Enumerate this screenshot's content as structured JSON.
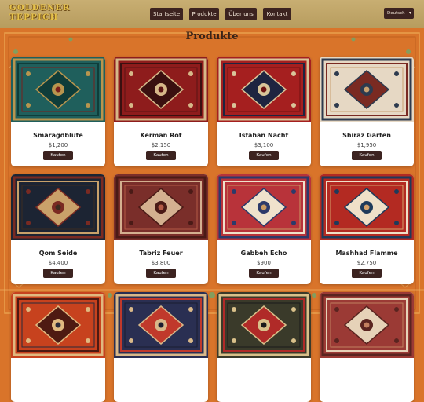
{
  "logo": {
    "line1": "GOLDENER",
    "line2": "TEPPICH"
  },
  "nav": [
    {
      "label": "Startseite"
    },
    {
      "label": "Produkte"
    },
    {
      "label": "Über uns"
    },
    {
      "label": "Kontakt"
    }
  ],
  "language": {
    "selected": "Deutsch"
  },
  "page_title": "Produkte",
  "buy_label": "Kaufen",
  "products": [
    {
      "name": "Smaragdblüte",
      "price": "$1,200",
      "colors": [
        "#1f5f5c",
        "#0f3d3a",
        "#b8954e",
        "#7a1f1c"
      ]
    },
    {
      "name": "Kerman Rot",
      "price": "$2,150",
      "colors": [
        "#8e1c1c",
        "#3a1010",
        "#d6b889",
        "#5b1414"
      ]
    },
    {
      "name": "Isfahan Nacht",
      "price": "$3,100",
      "colors": [
        "#a51f1f",
        "#1e2440",
        "#d9c59a",
        "#6e1212"
      ]
    },
    {
      "name": "Shiraz Garten",
      "price": "$1,950",
      "colors": [
        "#e6d8c4",
        "#7a2a22",
        "#2d3a4e",
        "#c9a070"
      ]
    },
    {
      "name": "Qom Seide",
      "price": "$4,400",
      "colors": [
        "#1c2433",
        "#c9a16a",
        "#7a2a22",
        "#3b2b20"
      ]
    },
    {
      "name": "Tabriz Feuer",
      "price": "$3,800",
      "colors": [
        "#7a2e2a",
        "#d4b090",
        "#4a1a16",
        "#b45a46"
      ]
    },
    {
      "name": "Gabbeh Echo",
      "price": "$900",
      "colors": [
        "#b8333a",
        "#efe2cc",
        "#2c3a6a",
        "#c99a62"
      ]
    },
    {
      "name": "Mashhad Flamme",
      "price": "$2,750",
      "colors": [
        "#b32a22",
        "#efe0c8",
        "#1e3a5a",
        "#d6a26a"
      ]
    },
    {
      "name": "",
      "price": "",
      "colors": [
        "#c7421e",
        "#4e1a12",
        "#e0b980",
        "#2a2a3a"
      ]
    },
    {
      "name": "",
      "price": "",
      "colors": [
        "#2a2f52",
        "#c0392b",
        "#d9b889",
        "#1a1d30"
      ]
    },
    {
      "name": "",
      "price": "",
      "colors": [
        "#3a3a2a",
        "#b02a28",
        "#d9c08a",
        "#1a1a1a"
      ]
    },
    {
      "name": "",
      "price": "",
      "colors": [
        "#9b3a35",
        "#e6d2b8",
        "#5a2420",
        "#c28060"
      ]
    }
  ]
}
